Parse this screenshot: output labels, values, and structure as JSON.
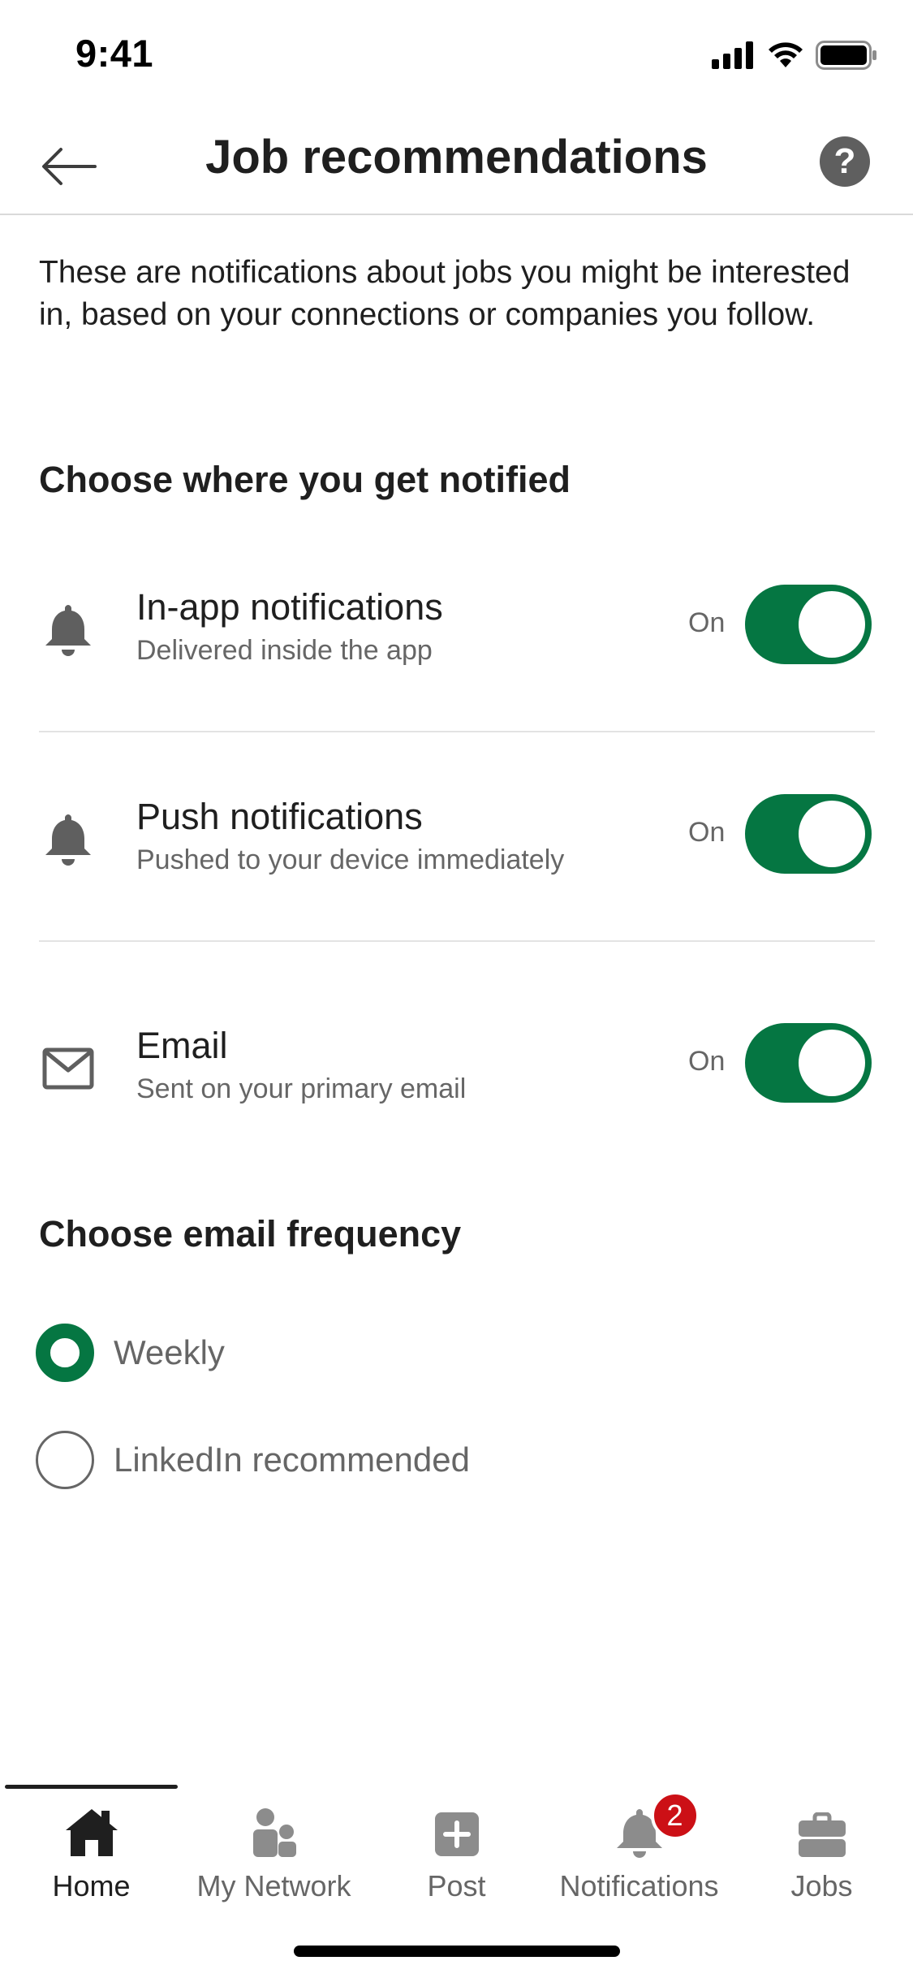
{
  "status_bar": {
    "time": "9:41"
  },
  "header": {
    "title": "Job recommendations",
    "help_label": "?"
  },
  "intro_text": "These are notifications about jobs you might be interested in, based on your connections or companies you follow.",
  "sections": {
    "channels_title": "Choose where you get notified",
    "frequency_title": "Choose email frequency"
  },
  "channels": [
    {
      "icon": "bell-icon",
      "title": "In-app notifications",
      "subtitle": "Delivered inside the app",
      "state": "On",
      "enabled": true
    },
    {
      "icon": "bell-icon",
      "title": "Push notifications",
      "subtitle": "Pushed to your device immediately",
      "state": "On",
      "enabled": true
    },
    {
      "icon": "envelope-icon",
      "title": "Email",
      "subtitle": "Sent on your primary email",
      "state": "On",
      "enabled": true
    }
  ],
  "frequency_options": [
    {
      "label": "Weekly",
      "selected": true
    },
    {
      "label": "LinkedIn recommended",
      "selected": false
    }
  ],
  "bottom_nav": [
    {
      "icon": "home-icon",
      "label": "Home",
      "active": true
    },
    {
      "icon": "network-icon",
      "label": "My Network",
      "active": false
    },
    {
      "icon": "post-icon",
      "label": "Post",
      "active": false
    },
    {
      "icon": "bell-icon",
      "label": "Notifications",
      "active": false,
      "badge": "2"
    },
    {
      "icon": "briefcase-icon",
      "label": "Jobs",
      "active": false
    }
  ],
  "colors": {
    "accent": "#057642",
    "badge": "#cc1016",
    "text": "#1f1f1f",
    "muted": "#666666"
  }
}
